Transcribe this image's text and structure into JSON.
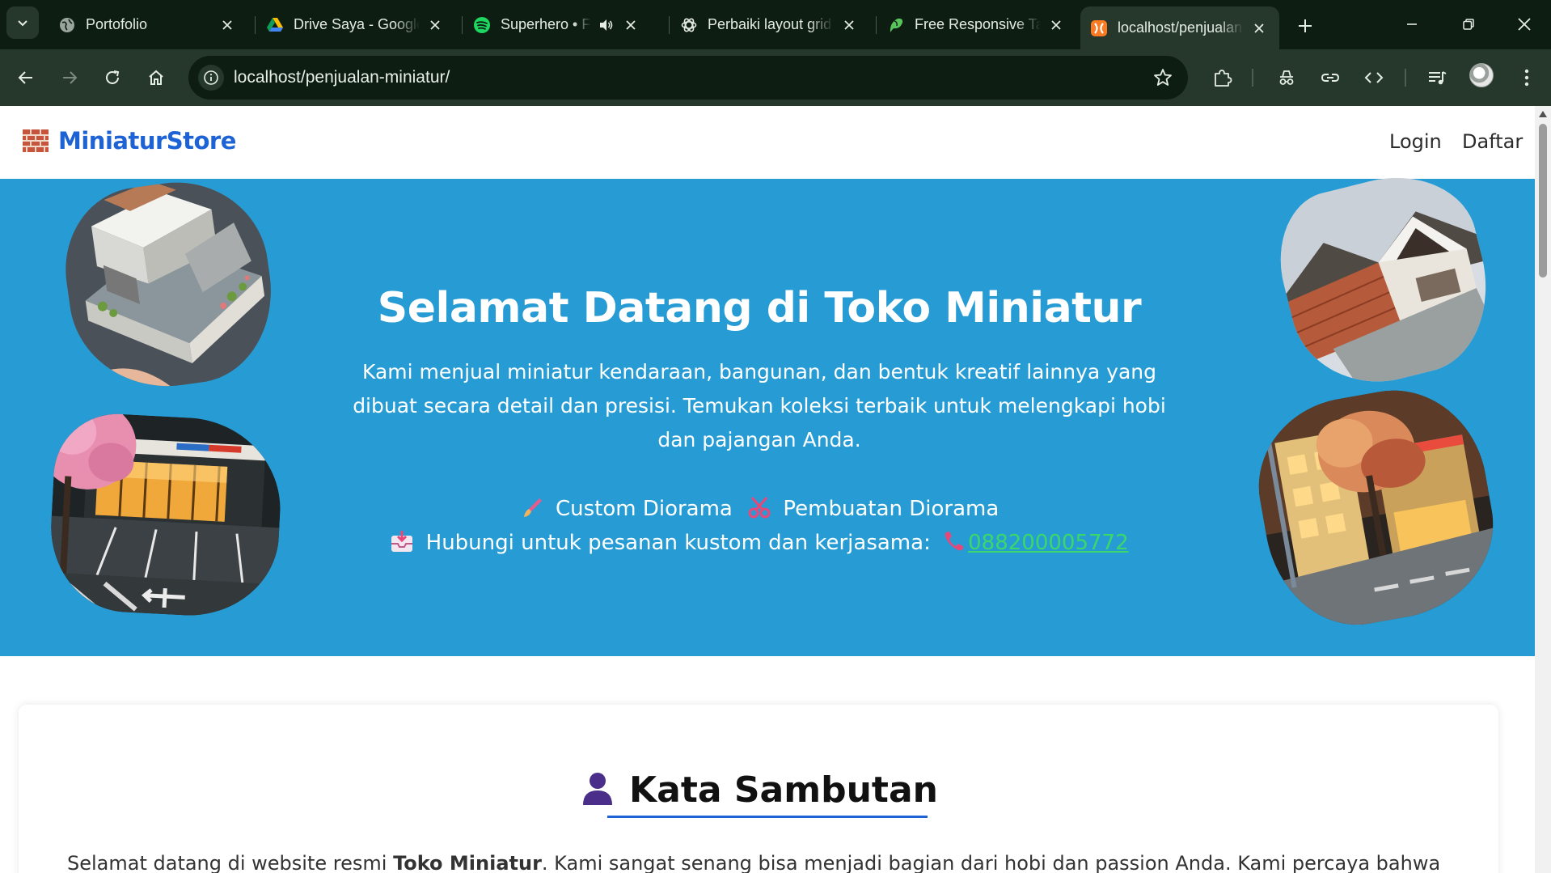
{
  "browser": {
    "tabs": [
      {
        "title": "Portofolio",
        "icon": "globe-icon"
      },
      {
        "title": "Drive Saya - Google Drive",
        "icon": "google-drive-icon"
      },
      {
        "title": "Superhero • Fanatic",
        "icon": "spotify-icon"
      },
      {
        "title": "Perbaiki layout grid",
        "icon": "chatgpt-icon"
      },
      {
        "title": "Free Responsive Tailwind",
        "icon": "leaf-icon"
      },
      {
        "title": "localhost/penjualan-miniatur/",
        "icon": "xampp-icon"
      }
    ],
    "active_tab": 5,
    "address": "localhost/penjualan-miniatur/"
  },
  "site": {
    "brand": "MiniaturStore",
    "nav": {
      "login": "Login",
      "register": "Daftar"
    }
  },
  "hero": {
    "title": "Selamat Datang di Toko Miniatur",
    "description": "Kami menjual miniatur kendaraan, bangunan, dan bentuk kreatif lainnya yang dibuat secara detail dan presisi. Temukan koleksi terbaik untuk melengkapi hobi dan pajangan Anda.",
    "service_1": "Custom Diorama",
    "service_2": "Pembuatan Diorama",
    "contact_label": "Hubungi untuk pesanan kustom dan kerjasama:",
    "phone": "088200005772"
  },
  "welcome": {
    "title": "Kata Sambutan",
    "text_before": "Selamat datang di website resmi ",
    "text_bold": "Toko Miniatur",
    "text_after": ". Kami sangat senang bisa menjadi bagian dari hobi dan passion Anda. Kami percaya bahwa"
  },
  "colors": {
    "brand": "#1d63d6",
    "hero_bg": "#279cd4",
    "phone_link": "#3ad86a",
    "chrome_dark": "#0e1d12",
    "chrome_toolbar": "#26382b"
  }
}
